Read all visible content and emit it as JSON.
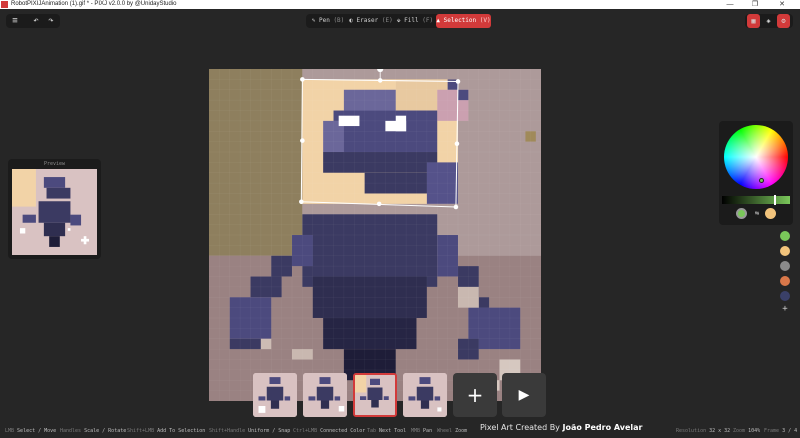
{
  "window": {
    "title": "RobotPIXIJAnimation (1).gif * - PIXJ v2.0.0 by @UnidayStudio",
    "controls": [
      "—",
      "❐",
      "✕"
    ]
  },
  "toolbar": {
    "tools": [
      {
        "label": "Pen",
        "key": "(B)",
        "icon": "pen-icon",
        "glyph": "✎"
      },
      {
        "label": "Eraser",
        "key": "(E)",
        "icon": "eraser-icon",
        "glyph": "◐"
      },
      {
        "label": "Fill",
        "key": "(F)",
        "icon": "fill-icon",
        "glyph": "⬙"
      },
      {
        "label": "Selection",
        "key": "(V)",
        "icon": "selection-icon",
        "glyph": "▲"
      }
    ],
    "active_tool": "Selection"
  },
  "preview": {
    "label": "Preview"
  },
  "palette": [
    "#7ac75a",
    "#f2c47c",
    "#8a8a8a",
    "#d9784a",
    "#3a4068"
  ],
  "colors": {
    "primary": "#7ac75a",
    "secondary": "#f2c47c",
    "accent": "#d23a3a"
  },
  "frames": {
    "count": 4,
    "selected": 3
  },
  "status": {
    "hints": [
      {
        "key": "LMB",
        "action": "Select / Move"
      },
      {
        "key": "Handles",
        "action": "Scale / Rotate"
      },
      {
        "key": "Shift+LMB",
        "action": "Add To Selection"
      },
      {
        "key": "Shift+Handle",
        "action": "Uniform / Snap"
      },
      {
        "key": "Ctrl+LMB",
        "action": "Connected Color"
      },
      {
        "key": "Tab",
        "action": "Next Tool"
      },
      {
        "key": "MMB",
        "action": "Pan"
      },
      {
        "key": "Wheel",
        "action": "Zoom"
      }
    ],
    "credit_prefix": "Pixel Art Created By",
    "credit_name": "João Pedro Avelar",
    "resolution_label": "Resolution",
    "resolution_value": "32 x 32",
    "zoom_label": "Zoom",
    "zoom_value": "104%",
    "frame_label": "Frame",
    "frame_value": "3 / 4"
  }
}
